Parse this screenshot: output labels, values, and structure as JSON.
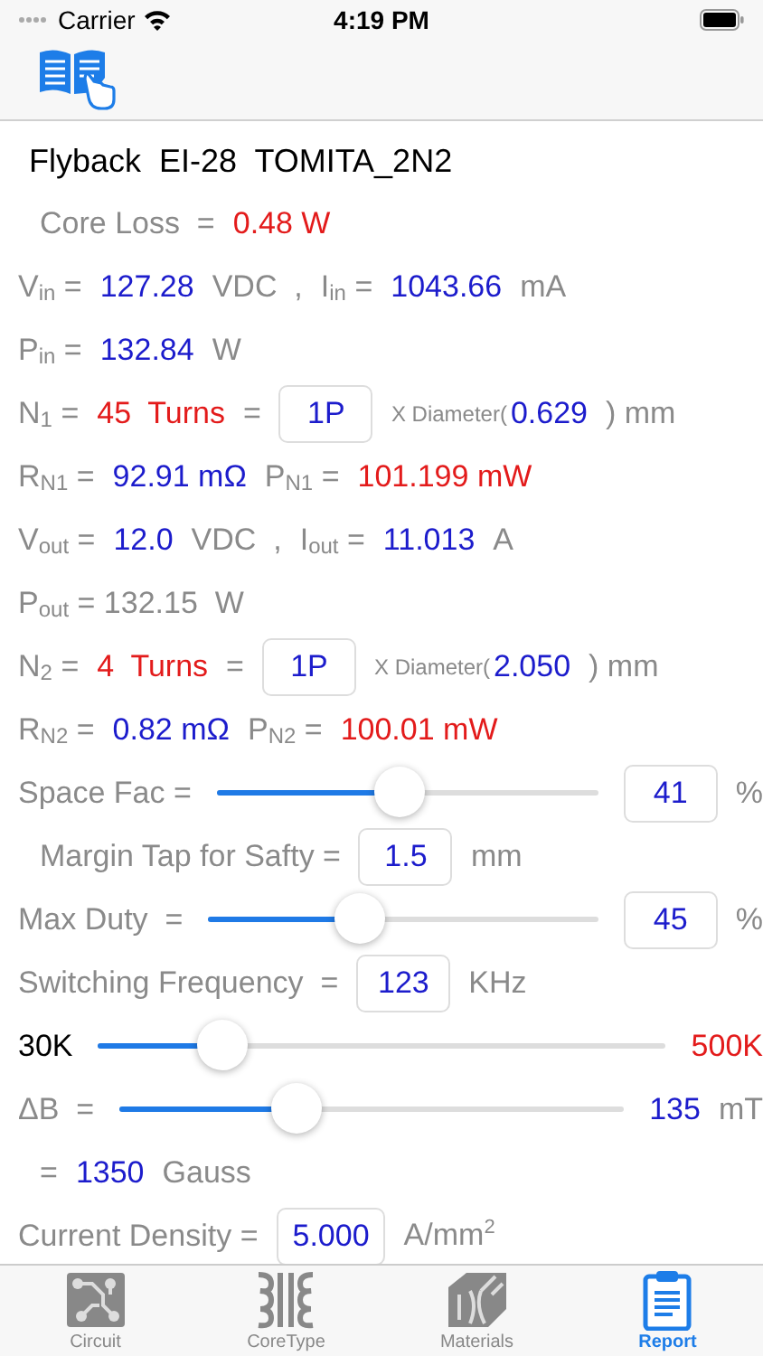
{
  "status_bar": {
    "carrier": "Carrier",
    "time": "4:19 PM"
  },
  "title": "Flyback  EI-28  TOMITA_2N2",
  "rows": [
    {
      "indent": true,
      "items": [
        {
          "kind": "label",
          "text": "Core Loss  ="
        },
        {
          "kind": "alert",
          "text": "0.48 W"
        }
      ]
    },
    {
      "items": [
        {
          "kind": "label",
          "text": "V$_{in}$ ="
        },
        {
          "kind": "value",
          "text": "127.28"
        },
        {
          "kind": "label",
          "text": "VDC  ,"
        },
        {
          "kind": "label",
          "text": "I$_{in}$ ="
        },
        {
          "kind": "value",
          "text": "1043.66"
        },
        {
          "kind": "label",
          "text": "mA"
        }
      ]
    },
    {
      "items": [
        {
          "kind": "label",
          "text": "P$_{in}$ ="
        },
        {
          "kind": "value",
          "text": "132.84"
        },
        {
          "kind": "label",
          "text": "W"
        }
      ]
    },
    {
      "items": [
        {
          "kind": "label",
          "text": "N$_{1}$ ="
        },
        {
          "kind": "alert",
          "text": "45  Turns"
        },
        {
          "kind": "label",
          "text": "="
        },
        {
          "kind": "field",
          "text": "1P"
        },
        {
          "kind": "small",
          "text": "X Diameter("
        },
        {
          "kind": "value",
          "text": "0.629"
        },
        {
          "kind": "label",
          "text": ") mm"
        }
      ]
    },
    {
      "items": [
        {
          "kind": "label",
          "text": "R$_{N1}$ ="
        },
        {
          "kind": "value",
          "text": "92.91 mΩ"
        },
        {
          "kind": "label",
          "text": "P$_{N1}$ ="
        },
        {
          "kind": "alert",
          "text": "101.199 mW"
        }
      ]
    },
    {
      "items": [
        {
          "kind": "label",
          "text": "V$_{out}$ ="
        },
        {
          "kind": "value",
          "text": "12.0"
        },
        {
          "kind": "label",
          "text": "VDC  ,"
        },
        {
          "kind": "label",
          "text": "I$_{out}$ ="
        },
        {
          "kind": "value",
          "text": "11.013"
        },
        {
          "kind": "label",
          "text": "A"
        }
      ]
    },
    {
      "items": [
        {
          "kind": "label",
          "text": "P$_{out}$ = 132.15  W"
        }
      ]
    },
    {
      "items": [
        {
          "kind": "label",
          "text": "N$_{2}$ ="
        },
        {
          "kind": "alert",
          "text": "4  Turns"
        },
        {
          "kind": "label",
          "text": "="
        },
        {
          "kind": "field",
          "text": "1P"
        },
        {
          "kind": "small",
          "text": "X Diameter("
        },
        {
          "kind": "value",
          "text": "2.050"
        },
        {
          "kind": "label",
          "text": ") mm"
        }
      ]
    },
    {
      "items": [
        {
          "kind": "label",
          "text": "R$_{N2}$ ="
        },
        {
          "kind": "value",
          "text": "0.82 mΩ"
        },
        {
          "kind": "label",
          "text": "P$_{N2}$ ="
        },
        {
          "kind": "alert",
          "text": "100.01 mW"
        }
      ]
    },
    {
      "items": [
        {
          "kind": "label",
          "text": "Space Fac ="
        },
        {
          "kind": "slider",
          "level": 0.48
        },
        {
          "kind": "field",
          "text": "41"
        },
        {
          "kind": "label",
          "text": "%"
        }
      ]
    },
    {
      "indent": true,
      "items": [
        {
          "kind": "label",
          "text": "Margin Tap for Safty ="
        },
        {
          "kind": "field",
          "text": "1.5"
        },
        {
          "kind": "label",
          "text": "mm"
        }
      ]
    },
    {
      "items": [
        {
          "kind": "label",
          "text": "Max Duty  ="
        },
        {
          "kind": "slider",
          "level": 0.39
        },
        {
          "kind": "field",
          "text": "45"
        },
        {
          "kind": "label",
          "text": "%"
        }
      ]
    },
    {
      "items": [
        {
          "kind": "label",
          "text": "Switching Frequency  ="
        },
        {
          "kind": "field",
          "text": "123"
        },
        {
          "kind": "label",
          "text": "KHz"
        }
      ]
    },
    {
      "items": [
        {
          "kind": "dark",
          "text": "30K"
        },
        {
          "kind": "slider",
          "level": 0.22
        },
        {
          "kind": "alert",
          "text": "500K"
        }
      ]
    },
    {
      "items": [
        {
          "kind": "label",
          "text": "ΔB  ="
        },
        {
          "kind": "slider",
          "level": 0.35
        },
        {
          "kind": "value",
          "text": "135"
        },
        {
          "kind": "label",
          "text": "mT"
        }
      ]
    },
    {
      "indent": true,
      "items": [
        {
          "kind": "label",
          "text": "="
        },
        {
          "kind": "value",
          "text": "1350"
        },
        {
          "kind": "label",
          "text": "Gauss"
        }
      ]
    },
    {
      "items": [
        {
          "kind": "label",
          "text": "Current Density ="
        },
        {
          "kind": "field",
          "text": "5.000"
        },
        {
          "kind": "label",
          "text": "A/mm$^{2}$"
        }
      ]
    }
  ],
  "tabs": [
    {
      "label": "Circuit",
      "selected": false
    },
    {
      "label": "CoreType",
      "selected": false
    },
    {
      "label": "Materials",
      "selected": false
    },
    {
      "label": "Report",
      "selected": true
    }
  ]
}
